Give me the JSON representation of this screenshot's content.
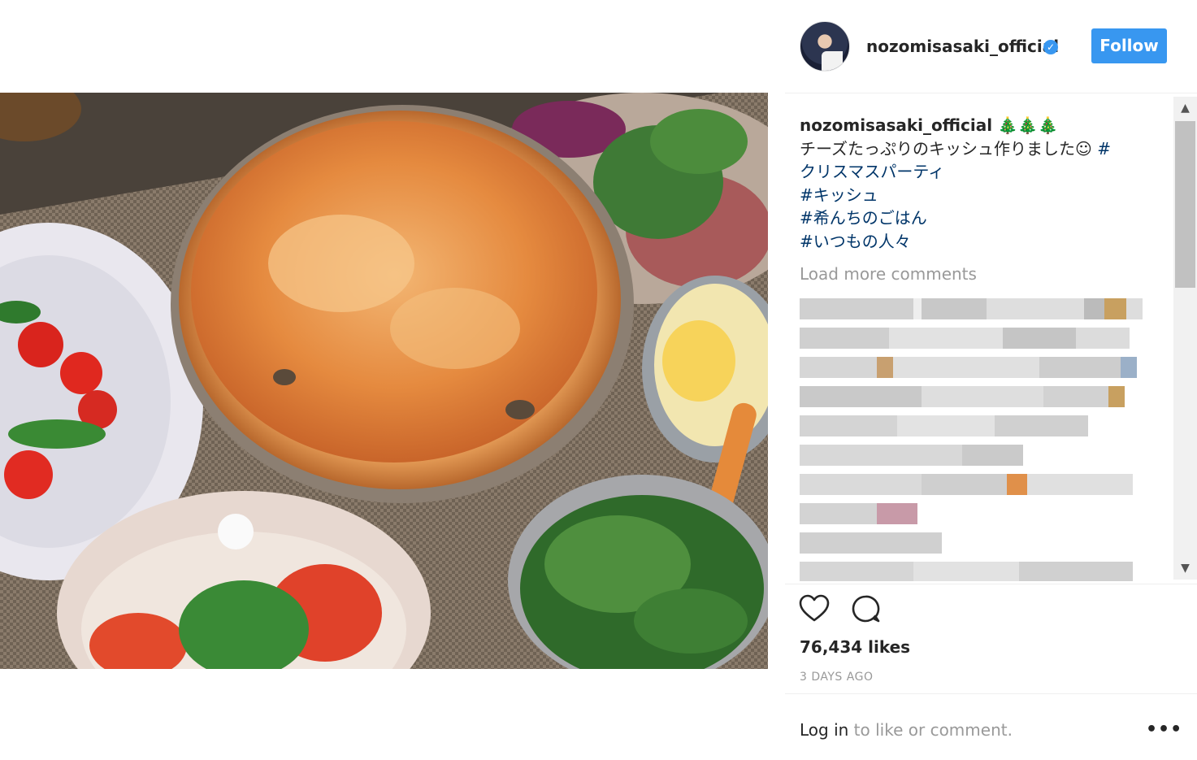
{
  "post": {
    "username": "nozomisasaki_official",
    "follow_label": "Follow",
    "caption": {
      "emoji": "🎄🎄🎄",
      "line1": "チーズたっぷりのキッシュ作りました☺ ",
      "tag1_hash": "#",
      "tag1": "クリスマスパーティ",
      "tag2": "#キッシュ",
      "tag3": "#希んちのごはん",
      "tag4": "#いつもの人々"
    },
    "load_more_label": "Load more comments",
    "likes": "76,434 likes",
    "timestamp": "3 DAYS AGO",
    "login_link": "Log in",
    "login_rest": " to like or comment.",
    "more_label": "•••"
  },
  "icons": {
    "like": "heart-outline-icon",
    "comment": "speech-bubble-icon",
    "verified": "verified-badge-icon"
  },
  "colors": {
    "accent": "#3897f0",
    "hashtag": "#003569",
    "muted": "#999999"
  }
}
